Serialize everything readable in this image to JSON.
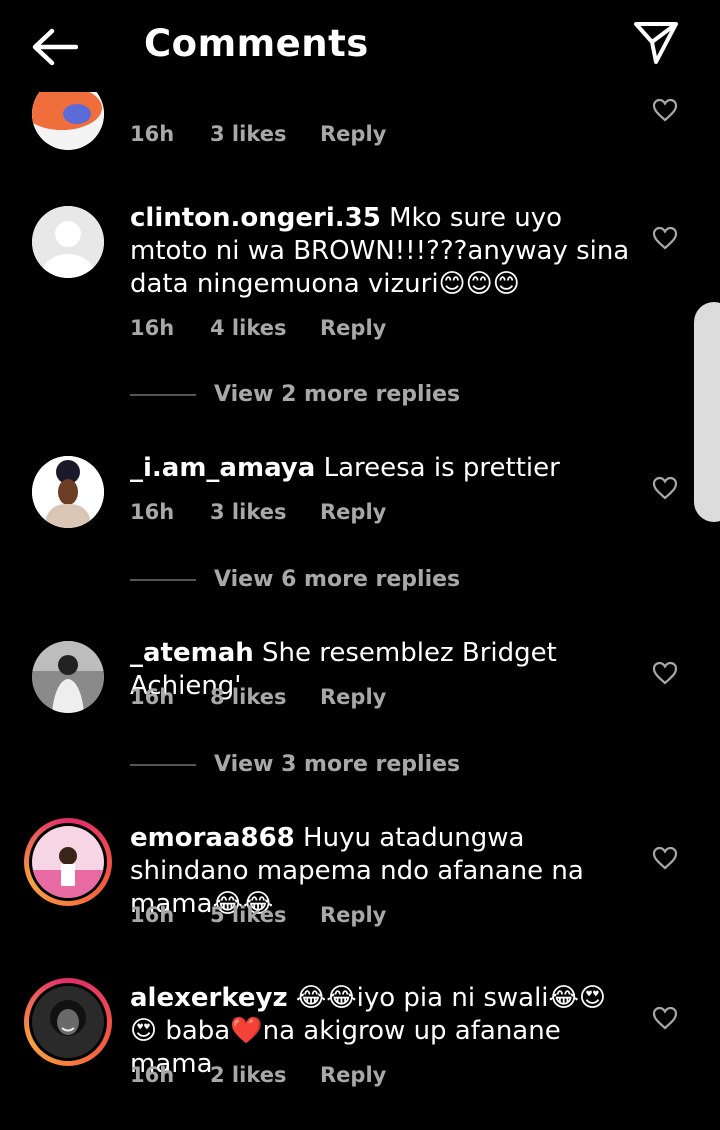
{
  "header": {
    "title": "Comments",
    "back_icon": "arrow-left-icon",
    "share_icon": "send-icon"
  },
  "comments": [
    {
      "username": "",
      "text": "",
      "time": "16h",
      "likes": "3 likes",
      "reply": "Reply",
      "avatar": "avatar-partial"
    },
    {
      "username": "clinton.ongeri.35",
      "text": "Mko sure uyo mtoto ni wa BROWN!!!???anyway sina data ningemuona vizuri😊😊😊",
      "time": "16h",
      "likes": "4 likes",
      "reply": "Reply",
      "view_replies": "View 2 more replies",
      "avatar": "default-avatar"
    },
    {
      "username": "_i.am_amaya",
      "text": "Lareesa is prettier",
      "time": "16h",
      "likes": "3 likes",
      "reply": "Reply",
      "view_replies": "View 6 more replies",
      "avatar": "illustrated-woman-avatar"
    },
    {
      "username": "_atemah",
      "text": "She resemblez Bridget Achieng'",
      "time": "16h",
      "likes": "8 likes",
      "reply": "Reply",
      "view_replies": "View 3 more replies",
      "avatar": "photo-avatar"
    },
    {
      "username": "emoraa868",
      "text": "Huyu atadungwa shindano mapema ndo afanane na mama😂😂",
      "time": "16h",
      "likes": "5 likes",
      "reply": "Reply",
      "avatar": "story-ring-avatar"
    },
    {
      "username": "alexerkeyz",
      "text": "😂😂iyo pia ni swali😂😍😍 baba❤️na akigrow up afanane mama",
      "time": "16h",
      "likes": "2 likes",
      "reply": "Reply",
      "avatar": "story-ring-avatar"
    }
  ],
  "colors": {
    "background": "#000000",
    "secondary_text": "#a8a8a8",
    "story_ring": "#e02b6d"
  }
}
